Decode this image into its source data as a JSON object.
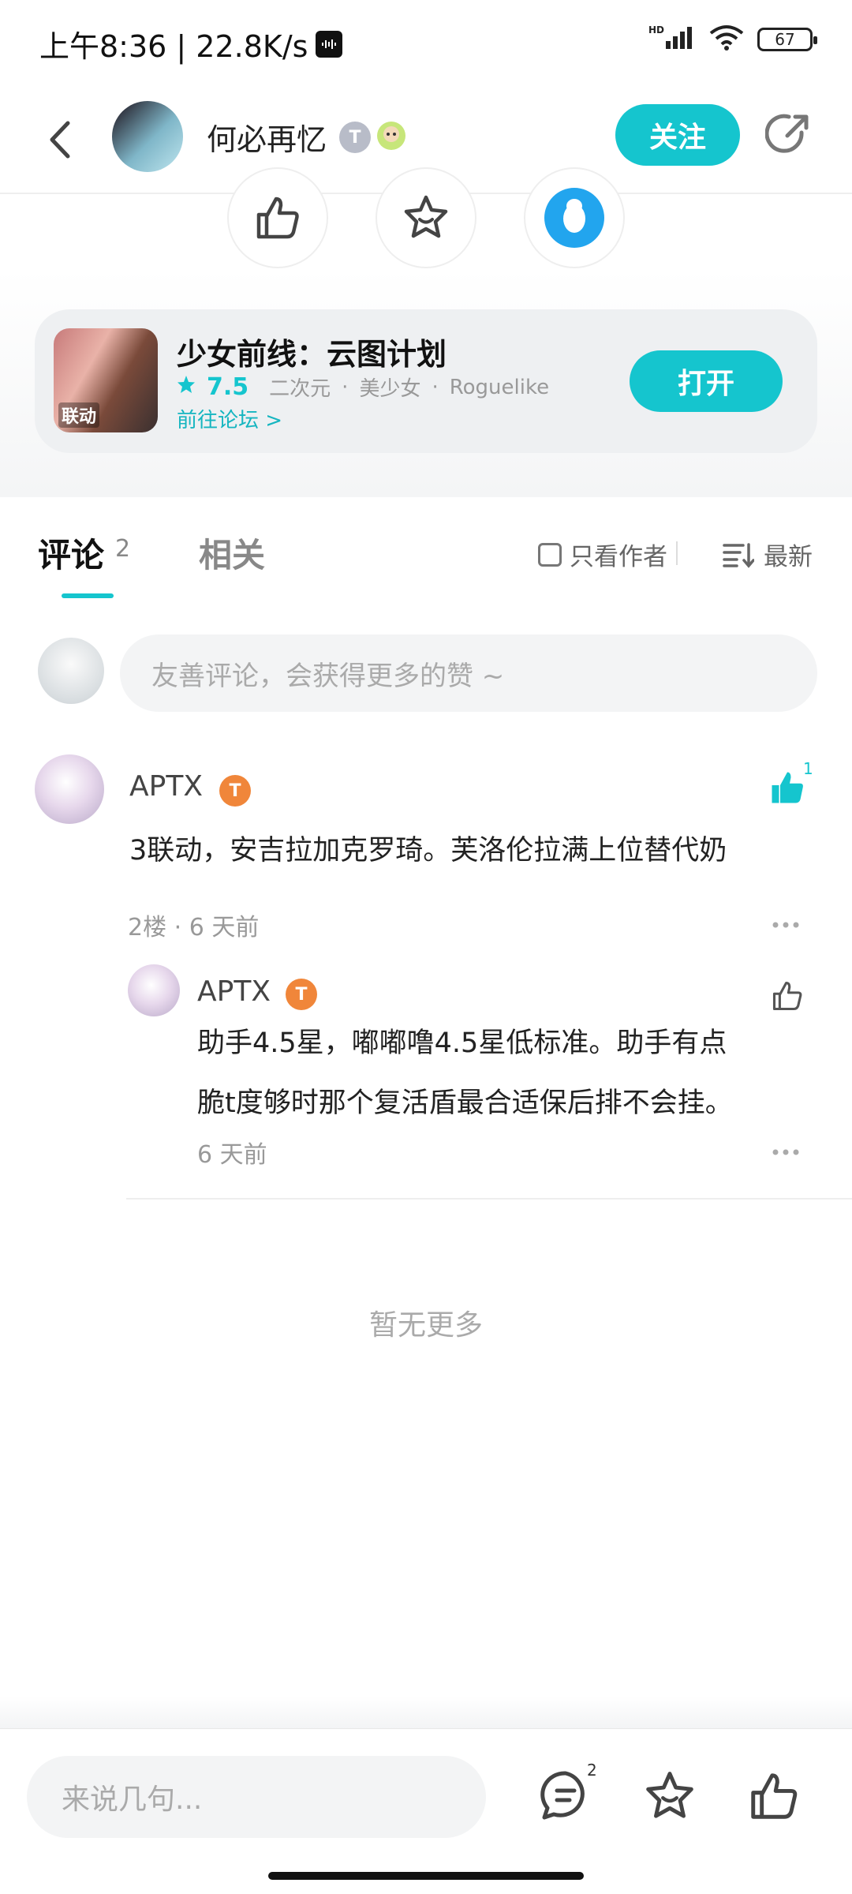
{
  "status_bar": {
    "time_speed": "上午8:36 | 22.8K/s",
    "hd": "HD",
    "battery": "67"
  },
  "header": {
    "username": "何必再忆",
    "level_badge": "T",
    "follow_label": "关注"
  },
  "game": {
    "title": "少女前线：云图计划",
    "score": "7.5",
    "tags": [
      "二次元",
      "美少女",
      "Roguelike"
    ],
    "forum_link": "前往论坛 >",
    "icon_label": "联动",
    "open_label": "打开"
  },
  "tabs": {
    "comment_label": "评论",
    "comment_count": "2",
    "related_label": "相关",
    "only_author": "只看作者",
    "sort_label": "最新"
  },
  "composer": {
    "placeholder": "友善评论，会获得更多的赞 ~"
  },
  "comments": [
    {
      "author": "APTX",
      "badge": "T",
      "text": "3联动，安吉拉加克罗琦。芙洛伦拉满上位替代奶",
      "meta": "2楼 · 6 天前",
      "likes": "1",
      "replies": [
        {
          "author": "APTX",
          "badge": "T",
          "text_line1": "助手4.5星，嘟嘟噜4.5星低标准。助手有点",
          "text_line2": "脆t度够时那个复活盾最合适保后排不会挂。",
          "meta": "6 天前"
        }
      ]
    }
  ],
  "footer_note": "暂无更多",
  "bottom_bar": {
    "placeholder": "来说几句...",
    "comment_count": "2"
  },
  "colors": {
    "accent": "#15c5ce",
    "badge_orange": "#f0863a"
  }
}
